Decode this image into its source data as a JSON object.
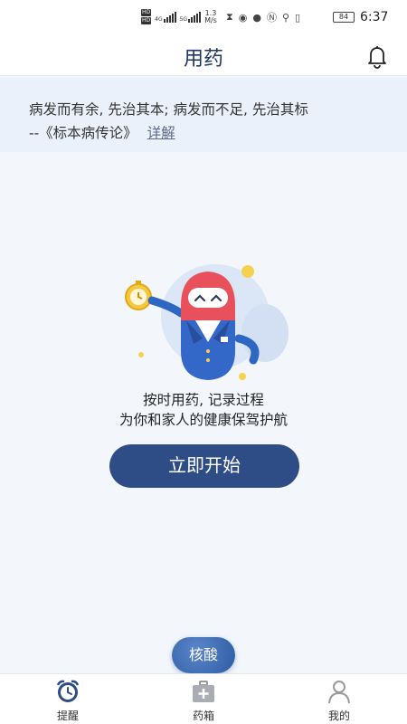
{
  "status_bar": {
    "network_badges": [
      "HD",
      "HD"
    ],
    "network_types": [
      "4G",
      "5G"
    ],
    "speed_value": "1.3",
    "speed_unit": "M/s",
    "battery": "84",
    "time": "6:37",
    "icons": [
      "hourglass-icon",
      "hotspot-icon",
      "message-icon",
      "nfc-icon",
      "location-icon",
      "vibrate-icon",
      "battery-icon"
    ]
  },
  "header": {
    "title": "用药",
    "bell_icon": "bell-icon"
  },
  "quote": {
    "text": "病发而有余, 先治其本; 病发而不足, 先治其标",
    "source": "--《标本病传论》",
    "detail_link": "详解"
  },
  "empty_state": {
    "line1": "按时用药, 记录过程",
    "line2": "为你和家人的健康保驾护航",
    "start_button": "立即开始"
  },
  "floating_button": {
    "label": "核酸"
  },
  "tabbar": {
    "items": [
      {
        "label": "提醒",
        "icon": "alarm-clock-icon",
        "active": true
      },
      {
        "label": "药箱",
        "icon": "medicine-box-icon",
        "active": false
      },
      {
        "label": "我的",
        "icon": "user-icon",
        "active": false
      }
    ]
  },
  "colors": {
    "primary": "#2e4c86",
    "title": "#1f3668",
    "background": "#f3f7fc",
    "quote_bg": "#eaf1fb"
  }
}
